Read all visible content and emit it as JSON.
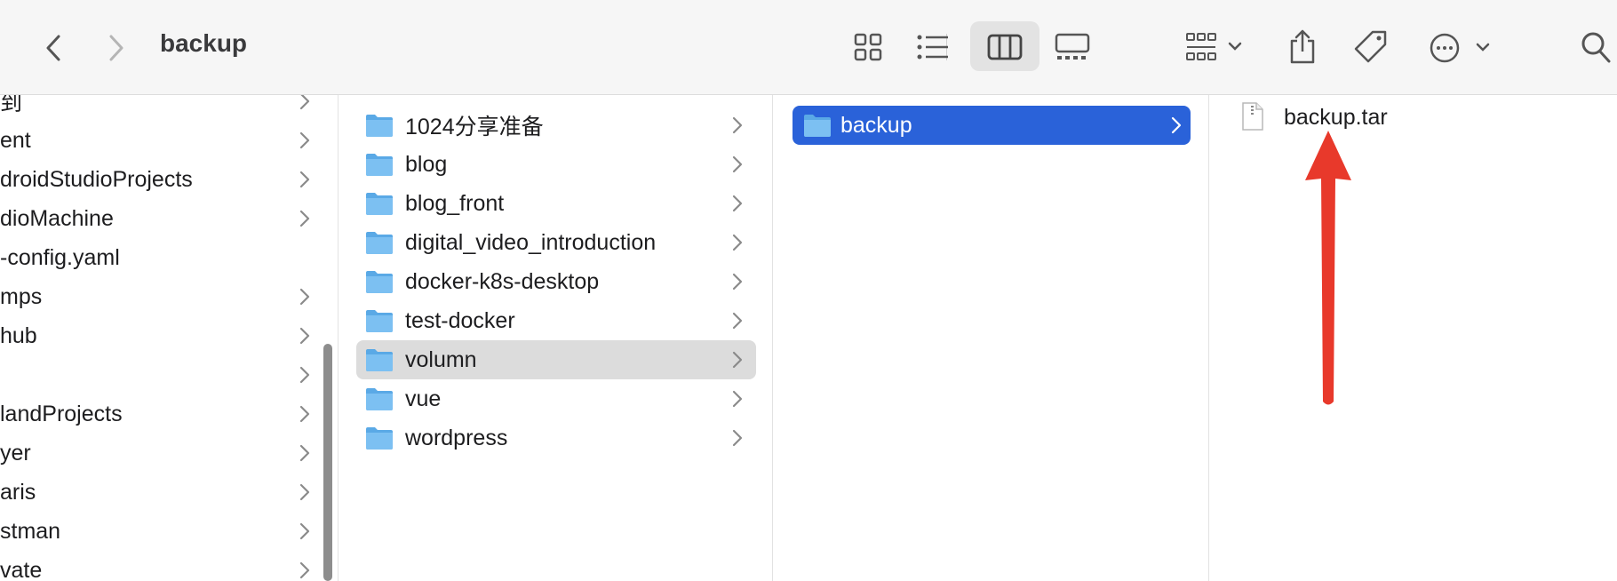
{
  "window": {
    "title": "backup"
  },
  "toolbar": {
    "back_icon": "chevron-left-icon",
    "forward_icon": "chevron-right-icon",
    "views": [
      "icon-view",
      "list-view",
      "column-view",
      "gallery-view"
    ],
    "active_view": "column-view",
    "group_icon": "group-by-icon",
    "share_icon": "share-icon",
    "tags_icon": "tag-icon",
    "more_icon": "ellipsis-circle-icon",
    "search_icon": "search-icon"
  },
  "columns": {
    "col1": {
      "items": [
        {
          "label": "到",
          "has_children": true
        },
        {
          "label": "ent",
          "has_children": true
        },
        {
          "label": "droidStudioProjects",
          "has_children": true
        },
        {
          "label": "dioMachine",
          "has_children": true
        },
        {
          "label": "-config.yaml",
          "has_children": false
        },
        {
          "label": "mps",
          "has_children": true
        },
        {
          "label": "hub",
          "has_children": true
        },
        {
          "label": "",
          "has_children": true
        },
        {
          "label": "landProjects",
          "has_children": true
        },
        {
          "label": "yer",
          "has_children": true
        },
        {
          "label": "aris",
          "has_children": true
        },
        {
          "label": "stman",
          "has_children": true
        },
        {
          "label": "vate",
          "has_children": true
        }
      ]
    },
    "col2": {
      "items": [
        {
          "label": "1024分享准备"
        },
        {
          "label": "blog"
        },
        {
          "label": "blog_front"
        },
        {
          "label": "digital_video_introduction"
        },
        {
          "label": "docker-k8s-desktop"
        },
        {
          "label": "test-docker"
        },
        {
          "label": "volumn"
        },
        {
          "label": "vue"
        },
        {
          "label": "wordpress"
        }
      ],
      "selected": "volumn"
    },
    "col3": {
      "items": [
        {
          "label": "backup"
        }
      ],
      "selected": "backup"
    },
    "col4": {
      "items": [
        {
          "label": "backup.tar",
          "icon": "file-icon"
        }
      ]
    }
  },
  "colors": {
    "selection_active": "#2a62d9",
    "selection_inactive": "#dcdcdc",
    "folder": "#6cb6ec",
    "annotation_arrow": "#e8392b"
  }
}
